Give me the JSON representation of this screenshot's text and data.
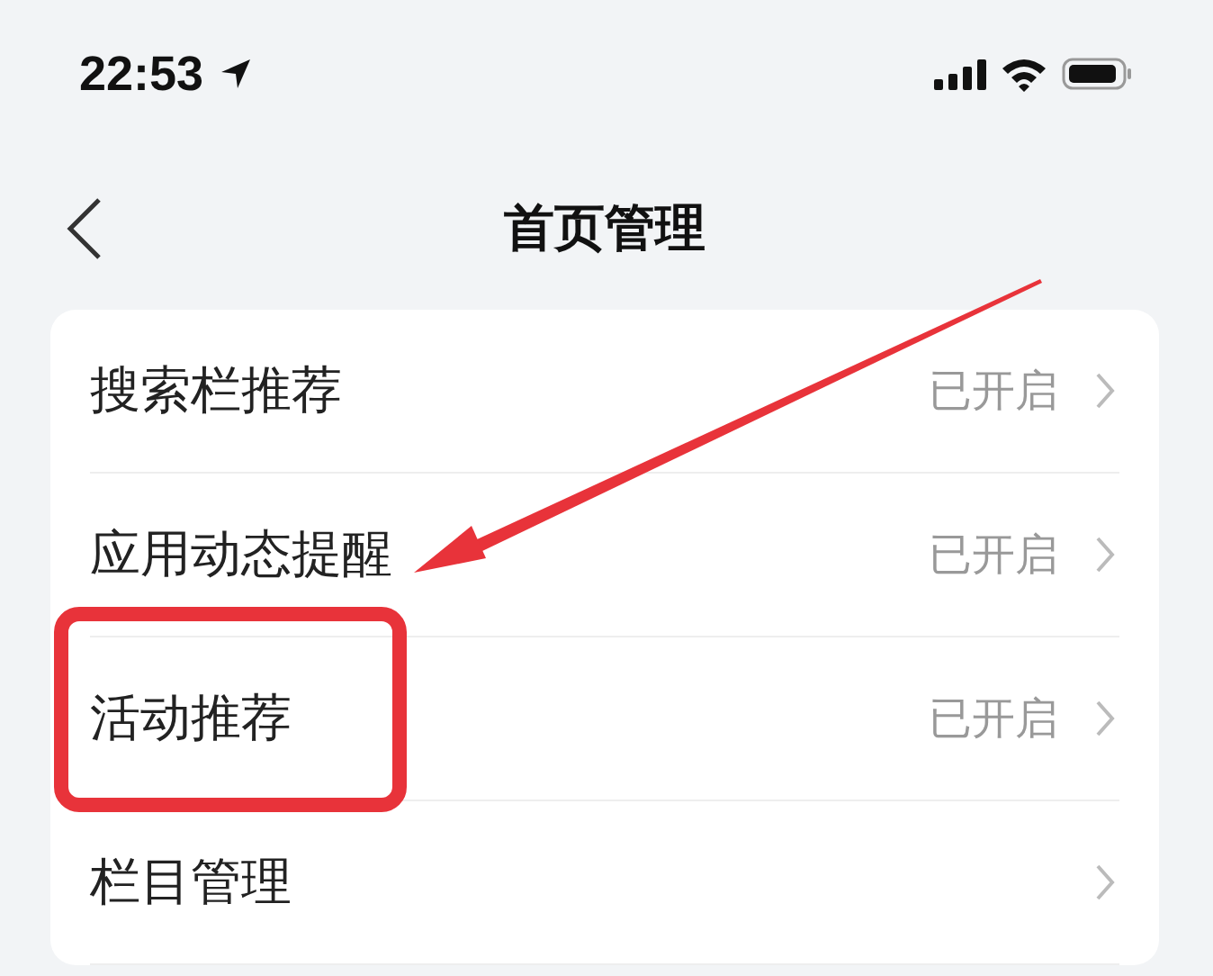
{
  "status_bar": {
    "time": "22:53"
  },
  "nav": {
    "title": "首页管理"
  },
  "settings": [
    {
      "label": "搜索栏推荐",
      "status": "已开启",
      "highlighted": false,
      "arrow_points_here": false
    },
    {
      "label": "应用动态提醒",
      "status": "已开启",
      "highlighted": false,
      "arrow_points_here": true
    },
    {
      "label": "活动推荐",
      "status": "已开启",
      "highlighted": true,
      "arrow_points_here": false
    },
    {
      "label": "栏目管理",
      "highlighted": false,
      "arrow_points_here": false
    }
  ]
}
